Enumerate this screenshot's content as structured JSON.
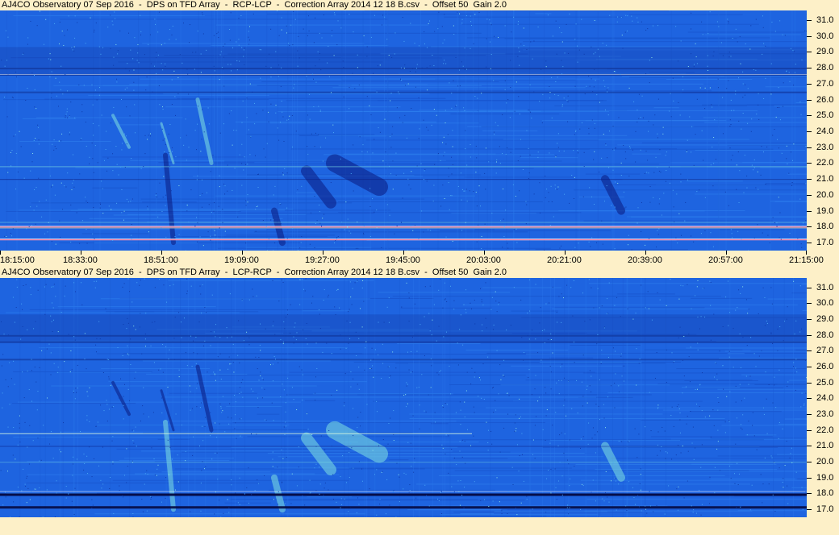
{
  "chart_data": [
    {
      "type": "heatmap",
      "title": "AJ4CO Observatory 07 Sep 2016  -  DPS on TFD Array  -  RCP-LCP  -  Correction Array 2014 12 18 B.csv  -  Offset 50  Gain 2.0",
      "xlabel": "",
      "ylabel": "",
      "x_tick_labels": [
        "18:15:00",
        "18:33:00",
        "18:51:00",
        "19:09:00",
        "19:27:00",
        "19:45:00",
        "20:03:00",
        "20:21:00",
        "20:39:00",
        "20:57:00",
        "21:15:00"
      ],
      "y_tick_labels": [
        "17.0",
        "18.0",
        "19.0",
        "20.0",
        "21.0",
        "22.0",
        "23.0",
        "24.0",
        "25.0",
        "26.0",
        "27.0",
        "28.0",
        "29.0",
        "30.0",
        "31.0"
      ],
      "ylim": [
        16.5,
        31.6
      ],
      "colormap": [
        "#0a1a80",
        "#1e64e0",
        "#3aa0f0",
        "#7fe0e0",
        "#ffffff",
        "#ff3060"
      ],
      "background": "#1e64e0",
      "features": {
        "bright_bands_mhz": [
          18.0,
          17.2
        ],
        "dark_bands_mhz": [
          28.0,
          27.6
        ],
        "burst_polarity": "positive"
      }
    },
    {
      "type": "heatmap",
      "title": "AJ4CO Observatory 07 Sep 2016  -  DPS on TFD Array  -  LCP-RCP  -  Correction Array 2014 12 18 B.csv  -  Offset 50  Gain 2.0",
      "xlabel": "",
      "ylabel": "",
      "x_tick_labels": [],
      "y_tick_labels": [
        "17.0",
        "18.0",
        "19.0",
        "20.0",
        "21.0",
        "22.0",
        "23.0",
        "24.0",
        "25.0",
        "26.0",
        "27.0",
        "28.0",
        "29.0",
        "30.0",
        "31.0"
      ],
      "ylim": [
        16.5,
        31.6
      ],
      "colormap": [
        "#0a1a80",
        "#1e64e0",
        "#3aa0f0",
        "#7fe0e0",
        "#ffffff"
      ],
      "background": "#1e64e0",
      "features": {
        "dark_bands_mhz": [
          18.0,
          17.2
        ],
        "burst_polarity": "negative"
      }
    }
  ]
}
